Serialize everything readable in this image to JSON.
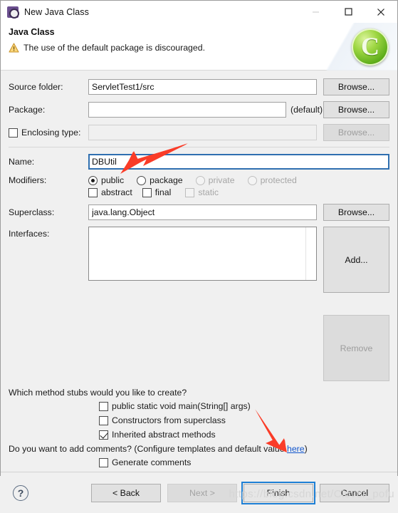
{
  "window": {
    "title": "New Java Class",
    "icon": "java-class-icon",
    "controls": {
      "minimize": "—",
      "maximize": "□",
      "close": "✕"
    }
  },
  "header": {
    "title": "Java Class",
    "warning_icon": "warning-triangle-icon",
    "message": "The use of the default package is discouraged.",
    "logo_letter": "C"
  },
  "form": {
    "source_folder": {
      "label": "Source folder:",
      "value": "ServletTest1/src",
      "button": "Browse..."
    },
    "package": {
      "label": "Package:",
      "value": "",
      "note": "(default)",
      "button": "Browse..."
    },
    "enclosing_type": {
      "label": "Enclosing type:",
      "checked": false,
      "value": "",
      "button": "Browse..."
    },
    "name": {
      "label": "Name:",
      "value": "DBUtil"
    },
    "modifiers": {
      "label": "Modifiers:",
      "access": [
        {
          "label": "public",
          "selected": true,
          "enabled": true
        },
        {
          "label": "package",
          "selected": false,
          "enabled": true
        },
        {
          "label": "private",
          "selected": false,
          "enabled": false
        },
        {
          "label": "protected",
          "selected": false,
          "enabled": false
        }
      ],
      "flags": [
        {
          "label": "abstract",
          "checked": false,
          "enabled": true
        },
        {
          "label": "final",
          "checked": false,
          "enabled": true
        },
        {
          "label": "static",
          "checked": false,
          "enabled": false
        }
      ]
    },
    "superclass": {
      "label": "Superclass:",
      "value": "java.lang.Object",
      "button": "Browse..."
    },
    "interfaces": {
      "label": "Interfaces:",
      "items": [],
      "add_button": "Add...",
      "remove_button": "Remove"
    }
  },
  "stubs": {
    "question": "Which method stubs would you like to create?",
    "options": [
      {
        "label": "public static void main(String[] args)",
        "checked": false
      },
      {
        "label": "Constructors from superclass",
        "checked": false
      },
      {
        "label": "Inherited abstract methods",
        "checked": true
      }
    ]
  },
  "comments": {
    "question_prefix": "Do you want to add comments? (Configure templates and default value ",
    "link": "here",
    "question_suffix": ")",
    "option": {
      "label": "Generate comments",
      "checked": false
    }
  },
  "footer": {
    "help_icon": "?",
    "buttons": [
      {
        "label": "< Back",
        "enabled": true,
        "focused": false
      },
      {
        "label": "Next >",
        "enabled": false,
        "focused": false
      },
      {
        "label": "Finish",
        "enabled": true,
        "focused": true
      },
      {
        "label": "Cancel",
        "enabled": true,
        "focused": false
      }
    ]
  },
  "watermark": "https://blog.csdn.net/Clover_pofu",
  "annotations": {
    "arrow_color": "#fa3c28",
    "arrows": [
      {
        "name": "arrow-to-name-field"
      },
      {
        "name": "arrow-to-finish-button"
      }
    ]
  }
}
